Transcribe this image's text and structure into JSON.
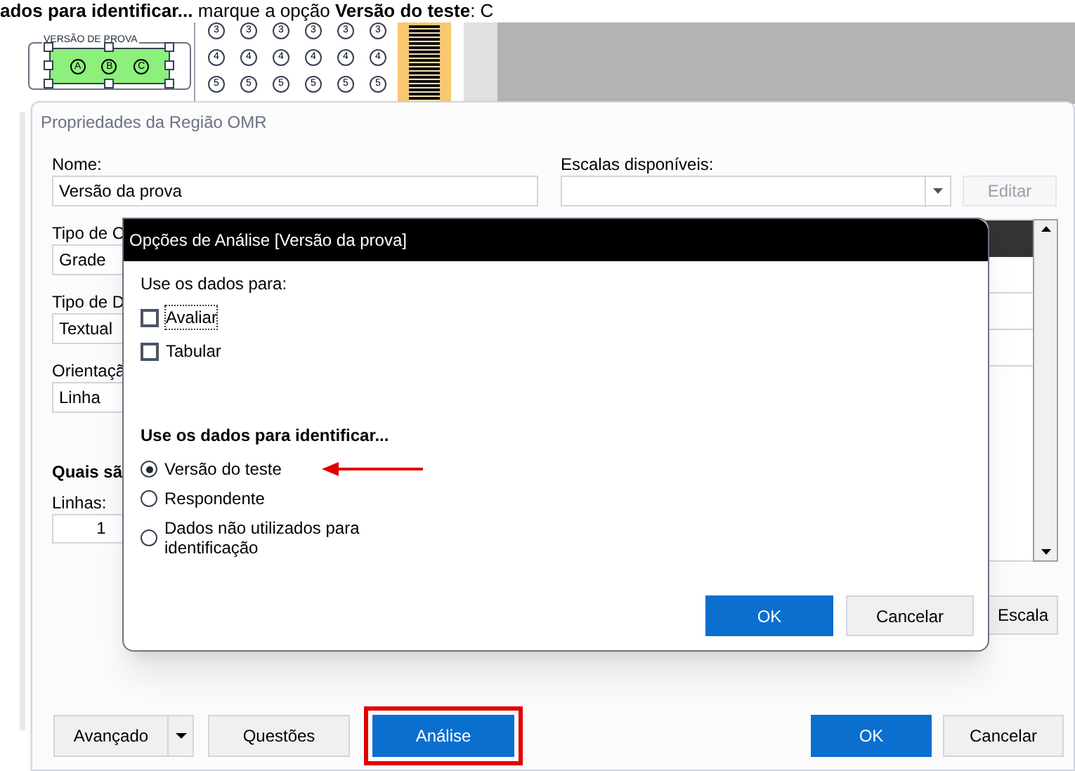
{
  "caption": "**ados para identificar...** marque a opção **Versão do teste**: C",
  "answer_sheet": {
    "version_label": "VERSÃO DE PROVA",
    "version_bubbles": [
      "A",
      "B",
      "C"
    ],
    "bubble_rows": [
      [
        "3",
        "3",
        "3",
        "3",
        "3",
        "3"
      ],
      [
        "4",
        "4",
        "4",
        "4",
        "4",
        "4"
      ],
      [
        "5",
        "5",
        "5",
        "5",
        "5",
        "5"
      ]
    ]
  },
  "main_dialog": {
    "title": "Propriedades da Região OMR",
    "fields": [
      {
        "label": "Nome:",
        "value": "Versão da prova"
      },
      {
        "label": "Tipo de C",
        "value": "Grade"
      },
      {
        "label": "Tipo de D",
        "value": "Textual"
      },
      {
        "label": "Orientaçã",
        "value": "Linha"
      }
    ],
    "section_label": "Quais sã",
    "rows_label": "Linhas:",
    "rows_value": "1",
    "scales_label": "Escalas disponíveis:",
    "edit_button": {
      "label": "Editar",
      "disabled": true
    },
    "scale_button": "Escala",
    "buttons": [
      {
        "label": "Avançado",
        "kind": "split",
        "primary": false,
        "highlighted": false
      },
      {
        "label": "Questões",
        "kind": "plain",
        "primary": false,
        "highlighted": false
      },
      {
        "label": "Análise",
        "kind": "plain",
        "primary": true,
        "highlighted": true
      }
    ],
    "footer_buttons": [
      {
        "label": "OK",
        "primary": true
      },
      {
        "label": "Cancelar",
        "primary": false
      }
    ]
  },
  "analysis_dialog": {
    "title": "Opções de Análise [Versão da prova]",
    "use_label": "Use os dados para:",
    "checkboxes": [
      {
        "label": "Avaliar",
        "checked": false,
        "focused": true
      },
      {
        "label": "Tabular",
        "checked": false,
        "focused": false
      }
    ],
    "identify_label": "Use os dados para identificar...",
    "radios": [
      {
        "label": "Versão do teste",
        "selected": true,
        "pointed": true
      },
      {
        "label": "Respondente",
        "selected": false,
        "pointed": false
      },
      {
        "label": "Dados não utilizados para identificação",
        "selected": false,
        "pointed": false
      }
    ],
    "buttons": [
      {
        "label": "OK",
        "primary": true
      },
      {
        "label": "Cancelar",
        "primary": false
      }
    ]
  }
}
